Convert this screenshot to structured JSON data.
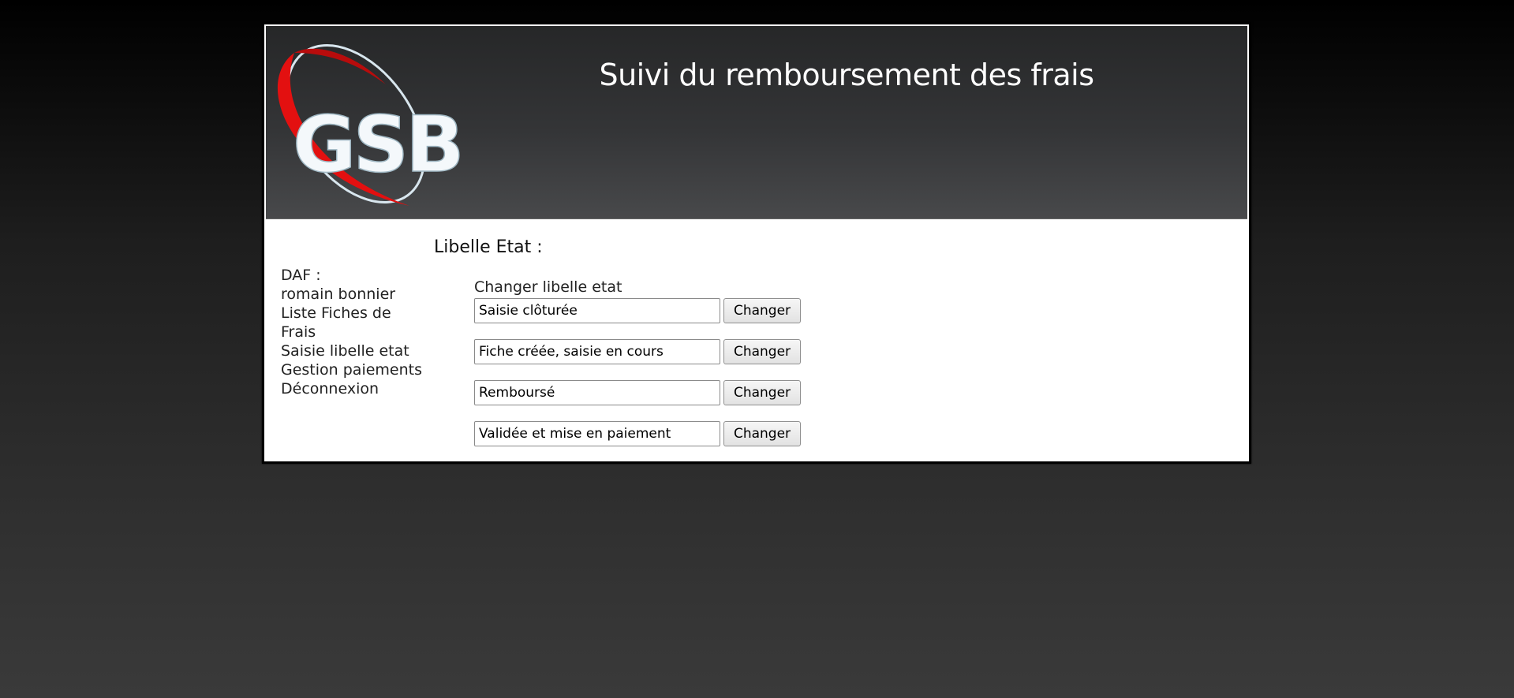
{
  "header": {
    "logo_text": "GSB",
    "title": "Suivi du remboursement des frais"
  },
  "sidebar": {
    "role_label": "DAF :",
    "user_name": "romain bonnier",
    "items": [
      {
        "label": "Liste Fiches de Frais"
      },
      {
        "label": "Saisie libelle etat"
      },
      {
        "label": "Gestion paiements"
      },
      {
        "label": "Déconnexion"
      }
    ]
  },
  "main": {
    "title": "Libelle Etat :",
    "form_heading": "Changer libelle etat",
    "rows": [
      {
        "value": "Saisie clôturée",
        "button_label": "Changer"
      },
      {
        "value": "Fiche créée, saisie en cours",
        "button_label": "Changer"
      },
      {
        "value": "Remboursé",
        "button_label": "Changer"
      },
      {
        "value": "Validée et mise en paiement",
        "button_label": "Changer"
      }
    ]
  },
  "colors": {
    "header_bg": "#343537",
    "logo_red": "#e31010",
    "logo_white": "#f4f8fb"
  }
}
